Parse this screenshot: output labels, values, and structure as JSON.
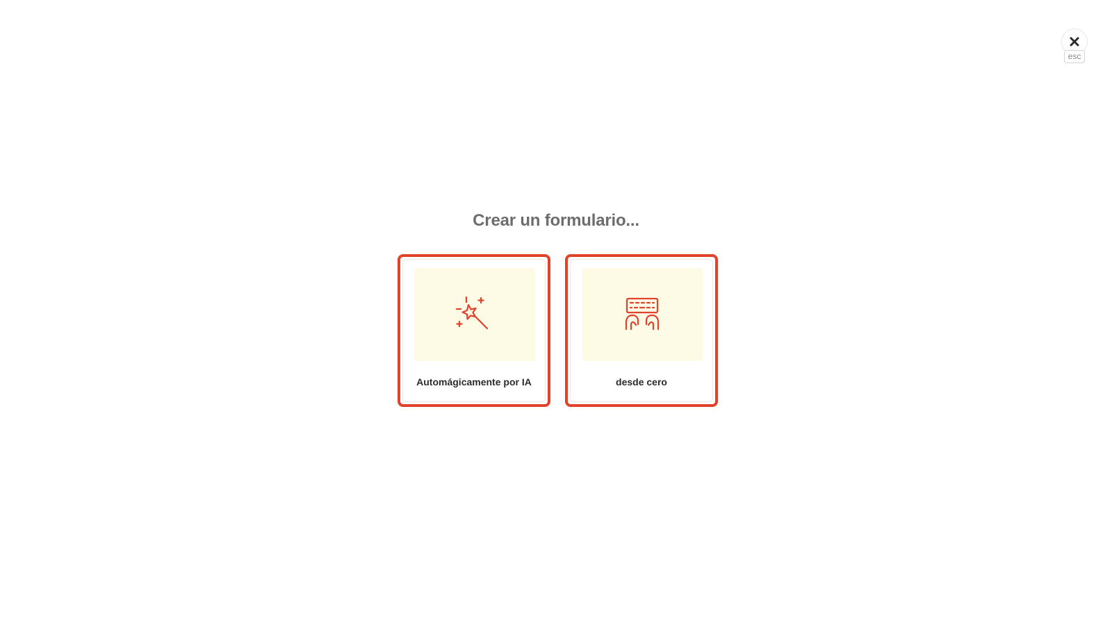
{
  "close": {
    "icon": "close-icon",
    "shortcut_label": "esc"
  },
  "dialog": {
    "title": "Crear un formulario..."
  },
  "options": [
    {
      "label": "Automágicamente por IA",
      "icon": "magic-wand-icon"
    },
    {
      "label": "desde cero",
      "icon": "keyboard-hands-icon"
    }
  ],
  "colors": {
    "accent": "#e2412b",
    "illustration_bg": "#fdfae6",
    "title": "#6d6d6d",
    "label": "#2b2b2b"
  }
}
